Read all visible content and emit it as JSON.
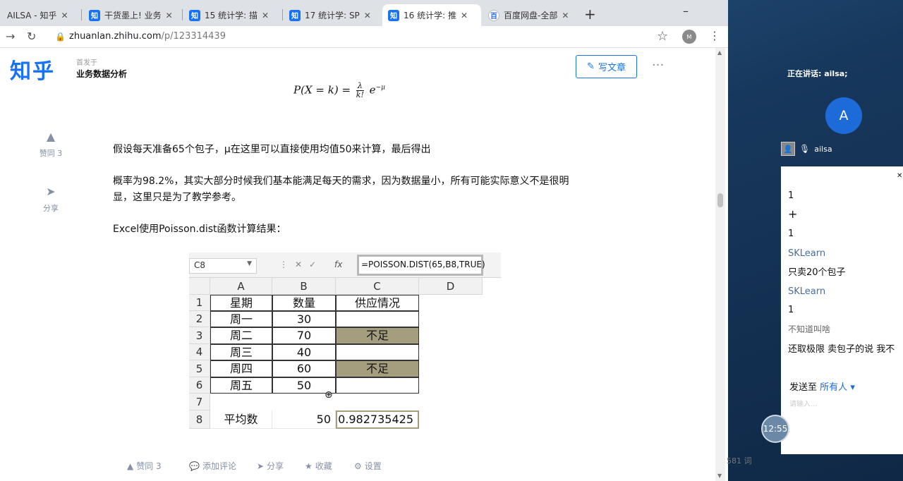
{
  "tabs": [
    {
      "icon": "",
      "title": "AILSA - 知乎",
      "active": false
    },
    {
      "icon": "知",
      "title": "干货墨上! 业务",
      "active": false
    },
    {
      "icon": "知",
      "title": "15 统计学: 描",
      "active": false
    },
    {
      "icon": "知",
      "title": "17 统计学: SP",
      "active": false
    },
    {
      "icon": "知",
      "title": "16 统计学: 推",
      "active": true
    },
    {
      "icon": "百",
      "title": "百度网盘-全部",
      "active": false
    }
  ],
  "address": {
    "host": "zhuanlan.zhihu.com",
    "path": "/p/123314439"
  },
  "header": {
    "logo": "知乎",
    "published": "首发于",
    "column": "业务数据分析",
    "write_label": "写文章",
    "more": "···"
  },
  "formula": {
    "lhs": "P(X = k) =",
    "frac_num": "λ",
    "frac_den": "k!",
    "rhs": "e",
    "exp": "−μ"
  },
  "side_tools": {
    "like": "赞同 3",
    "share": "分享"
  },
  "paragraphs": {
    "p1": "假设每天准备65个包子，μ在这里可以直接使用均值50来计算，最后得出",
    "p2": "概率为98.2%，其实大部分时候我们基本能满足每天的需求，因为数据量小，所有可能实际意义不是很明显，这里只是为了教学参考。",
    "p3": "Excel使用Poisson.dist函数计算结果："
  },
  "excel": {
    "name_box": "C8",
    "formula": "=POISSON.DIST(65,B8,TRUE)",
    "fx": "fx",
    "columns": [
      "A",
      "B",
      "C",
      "D"
    ],
    "rows": [
      "1",
      "2",
      "3",
      "4",
      "5",
      "6",
      "7",
      "8"
    ],
    "cells": {
      "A1": "星期",
      "B1": "数量",
      "C1": "供应情况",
      "A2": "周一",
      "B2": "30",
      "C2": "",
      "A3": "周二",
      "B3": "70",
      "C3": "不足",
      "A4": "周三",
      "B4": "40",
      "C4": "",
      "A5": "周四",
      "B5": "60",
      "C5": "不足",
      "A6": "周五",
      "B6": "50",
      "C6": "",
      "A8": "平均数",
      "B8": "50",
      "C8": "0.982735425"
    }
  },
  "bottom_bar": {
    "like": "赞同 3",
    "comment": "添加评论",
    "share": "分享",
    "favorite": "收藏",
    "settings": "设置"
  },
  "word_count": "581 词",
  "meeting": {
    "speaking": "正在讲话: ailsa;",
    "avatar_letter": "A",
    "user": "ailsa",
    "clock": "12:55"
  },
  "chat": {
    "messages": [
      {
        "text": "1",
        "kind": "msg"
      },
      {
        "text": "+",
        "kind": "msg"
      },
      {
        "text": "1",
        "kind": "msg"
      },
      {
        "text": "SKLearn",
        "kind": "name"
      },
      {
        "text": "只卖20个包子",
        "kind": "msg"
      },
      {
        "text": "SKLearn",
        "kind": "name"
      },
      {
        "text": "1",
        "kind": "msg"
      },
      {
        "text": "不知道叫啥",
        "kind": "gray"
      },
      {
        "text": "还取极限 卖包子的说 我不",
        "kind": "msg"
      }
    ],
    "send_to_label": "发送至",
    "send_to_target": "所有人",
    "input_hint": "请输入..."
  }
}
